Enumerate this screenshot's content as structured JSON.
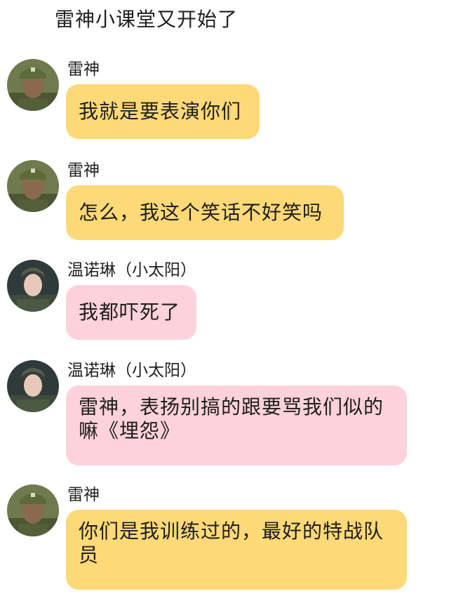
{
  "chat": {
    "title": "雷神小课堂又开始了"
  },
  "messages": [
    {
      "sender": "雷神",
      "text": "我就是要表演你们",
      "bubble_color": "#fdd978",
      "avatar_icon": "soldier-avatar-icon"
    },
    {
      "sender": "雷神",
      "text": "怎么，我这个笑话不好笑吗",
      "bubble_color": "#fdd978",
      "avatar_icon": "soldier-avatar-icon"
    },
    {
      "sender": "温诺琳（小太阳）",
      "text": "我都吓死了",
      "bubble_color": "#fdd2dc",
      "avatar_icon": "female-soldier-avatar-icon"
    },
    {
      "sender": "温诺琳（小太阳）",
      "text": "雷神，表扬别搞的跟要骂我们似的嘛《埋怨》",
      "bubble_color": "#fdd2dc",
      "avatar_icon": "female-soldier-avatar-icon"
    },
    {
      "sender": "雷神",
      "text": "你们是我训练过的，最好的特战队员",
      "bubble_color": "#fdd978",
      "avatar_icon": "soldier-avatar-icon"
    }
  ]
}
